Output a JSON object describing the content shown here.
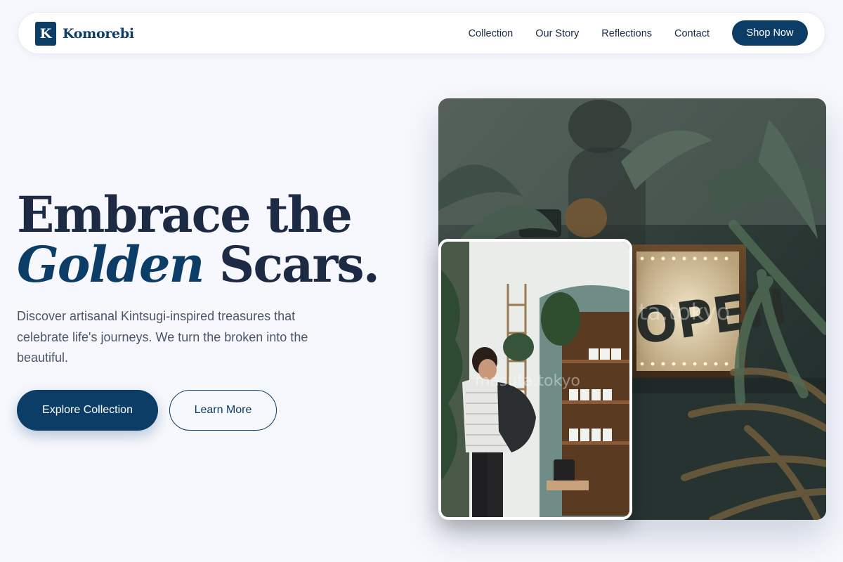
{
  "brand": {
    "mark": "K",
    "name": "Komorebi"
  },
  "nav": {
    "links": [
      "Collection",
      "Our Story",
      "Reflections",
      "Contact"
    ],
    "cta": "Shop Now"
  },
  "hero": {
    "title_line1": "Embrace the",
    "title_accent": "Golden",
    "title_line2_rest": " Scars.",
    "description": "Discover artisanal Kintsugi-inspired treasures that celebrate life's journeys. We turn the broken into the beautiful.",
    "primary_cta": "Explore Collection",
    "secondary_cta": "Learn More"
  },
  "images": {
    "main_sign_text": "OPEN",
    "watermark_main": "ta.tokyo",
    "watermark_inset": "masuta.tokyo"
  },
  "colors": {
    "brand": "#0c3d66",
    "background": "#f6f8fd",
    "text": "#1c2a44",
    "muted": "#4a5568"
  }
}
